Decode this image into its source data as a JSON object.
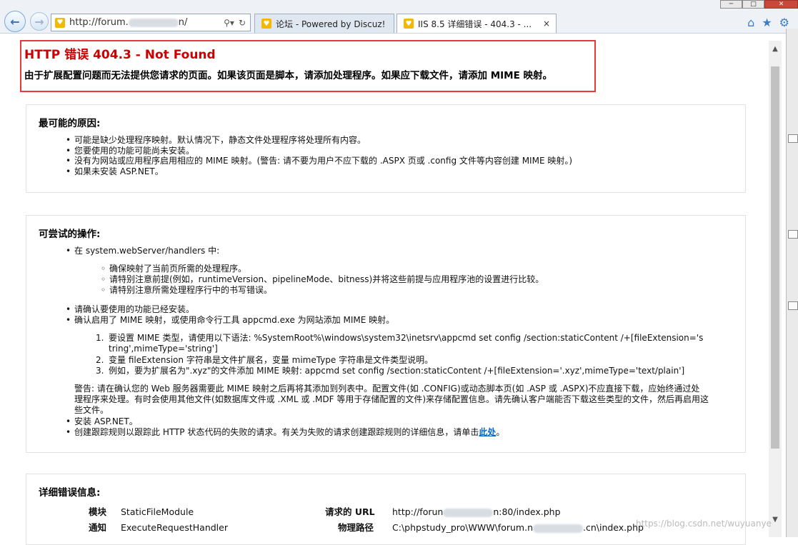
{
  "browser": {
    "address": {
      "prefix": "http://forum.",
      "suffix": "n/"
    },
    "tabs": [
      {
        "label": "论坛 - Powered by Discuz!"
      },
      {
        "label": "IIS 8.5 详细错误 - 404.3 - ...",
        "close": "×"
      }
    ],
    "window_controls": {
      "minimize": "─",
      "maximize": "□",
      "close": "✕"
    },
    "icons": {
      "home": "⌂",
      "favorites": "★",
      "settings": "⚙"
    }
  },
  "error": {
    "title": "HTTP 错误 404.3 - Not Found",
    "description": "由于扩展配置问题而无法提供您请求的页面。如果该页面是脚本，请添加处理程序。如果应下载文件，请添加 MIME 映射。"
  },
  "causes": {
    "title": "最可能的原因:",
    "items": [
      "可能是缺少处理程序映射。默认情况下，静态文件处理程序将处理所有内容。",
      "您要使用的功能可能尚未安装。",
      "没有为网站或应用程序启用相应的 MIME 映射。(警告: 请不要为用户不应下载的 .ASPX 页或 .config 文件等内容创建 MIME 映射。)",
      "如果未安装 ASP.NET。"
    ]
  },
  "actions": {
    "title": "可尝试的操作:",
    "handlers_item": "在 system.webServer/handlers 中:",
    "sub_items": [
      "确保映射了当前页所需的处理程序。",
      "请特别注意前提(例如，runtimeVersion、pipelineMode、bitness)并将这些前提与应用程序池的设置进行比较。",
      "请特别注意所需处理程序行中的书写错误。"
    ],
    "item_feature": "请确认要使用的功能已经安装。",
    "item_mime": "确认启用了 MIME 映射，或使用命令行工具 appcmd.exe 为网站添加 MIME 映射。",
    "numbered": [
      {
        "n": "1.",
        "lines": [
          "要设置 MIME 类型，请使用以下语法: %SystemRoot%\\windows\\system32\\inetsrv\\appcmd set config /section:staticContent /+[fileExtension='s",
          "tring',mimeType='string']"
        ]
      },
      {
        "n": "2.",
        "lines": [
          "变量 fileExtension 字符串是文件扩展名，变量 mimeType 字符串是文件类型说明。"
        ]
      },
      {
        "n": "3.",
        "lines": [
          "例如，要为扩展名为\".xyz\"的文件添加 MIME 映射: appcmd set config /section:staticContent /+[fileExtension='.xyz',mimeType='text/plain']"
        ]
      }
    ],
    "warning_lines": [
      "警告: 请在确认您的 Web 服务器需要此 MIME 映射之后再将其添加到列表中。配置文件(如 .CONFIG)或动态脚本页(如 .ASP 或 .ASPX)不应直接下载，应始终通过处",
      "理程序来处理。有时会使用其他文件(如数据库文件或 .XML 或 .MDF 等用于存储配置的文件)来存储配置信息。请先确认客户端能否下载这些类型的文件，然后再启用这",
      "些文件。"
    ],
    "item_aspnet": "安装 ASP.NET。",
    "item_trace": "创建跟踪规则以跟踪此 HTTP 状态代码的失败的请求。有关为失败的请求创建跟踪规则的详细信息，请单击",
    "trace_link": "此处",
    "trace_end": "。"
  },
  "details": {
    "title": "详细错误信息:",
    "rows": [
      {
        "label": "模块",
        "value": "StaticFileModule",
        "label2": "请求的 URL",
        "value2_a": "http://forun",
        "value2_b": "n:80/index.php"
      },
      {
        "label": "通知",
        "value": "ExecuteRequestHandler",
        "label2": "物理路径",
        "value2_a": "C:\\phpstudy_pro\\WWW\\forum.n",
        "value2_b": ".cn\\index.php"
      }
    ]
  },
  "watermark": "https://blog.csdn.net/wuyuanye"
}
